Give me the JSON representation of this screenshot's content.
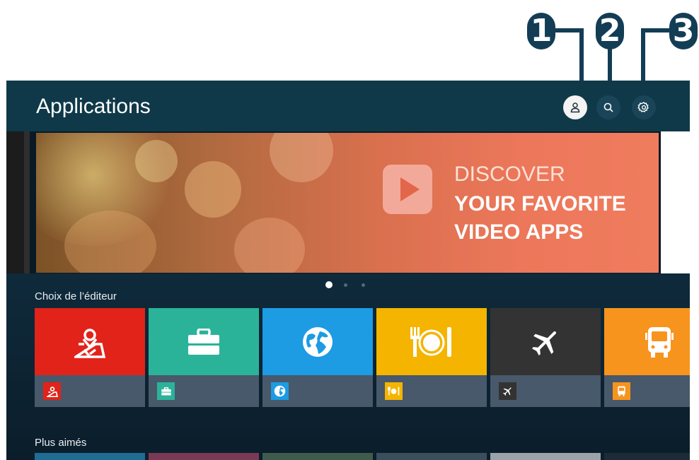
{
  "callouts": [
    "1",
    "2",
    "3"
  ],
  "header": {
    "title": "Applications",
    "icons": [
      "profile-icon",
      "search-icon",
      "settings-icon"
    ]
  },
  "banner": {
    "line1": "DISCOVER",
    "line2": "YOUR FAVORITE",
    "line3": "VIDEO APPS",
    "icon": "play-icon",
    "page_count": 3,
    "active_page": 1
  },
  "sections": {
    "editors_choice": {
      "title": "Choix de l’éditeur",
      "tiles": [
        {
          "icon": "map-pin-icon",
          "color": "#e2231a"
        },
        {
          "icon": "briefcase-icon",
          "color": "#2bb39a"
        },
        {
          "icon": "globe-icon",
          "color": "#1d9be3"
        },
        {
          "icon": "restaurant-icon",
          "color": "#f4b400"
        },
        {
          "icon": "airplane-icon",
          "color": "#333333"
        },
        {
          "icon": "bus-icon",
          "color": "#f7941d"
        }
      ]
    },
    "most_liked": {
      "title": "Plus aimés"
    }
  },
  "colors": {
    "background": "#0f3949",
    "tile_bottom": "#47596a",
    "callout": "#123d55"
  }
}
